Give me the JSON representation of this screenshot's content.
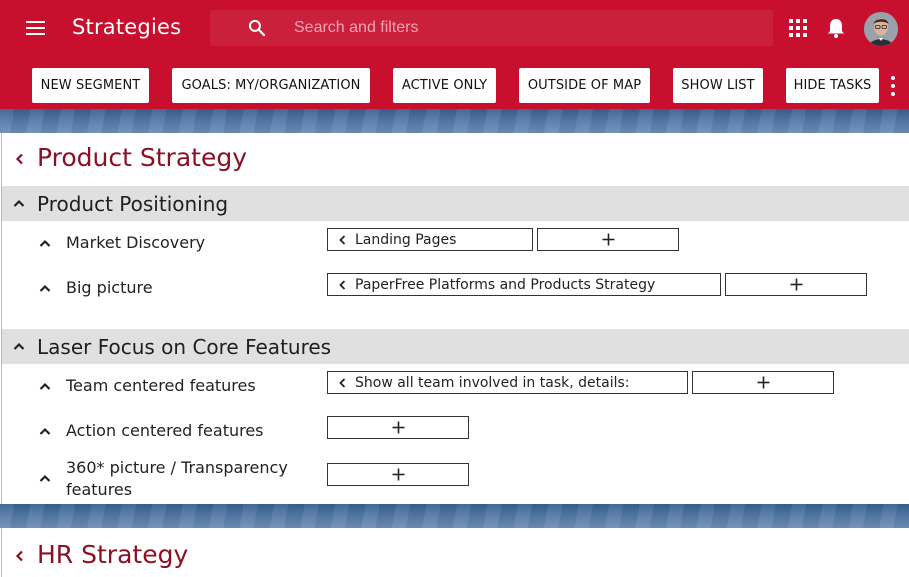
{
  "app": {
    "title": "Strategies"
  },
  "search": {
    "placeholder": "Search and filters"
  },
  "toolbar": {
    "chips": [
      "NEW SEGMENT",
      "GOALS: MY/ORGANIZATION",
      "ACTIVE ONLY",
      "OUTSIDE OF MAP",
      "SHOW LIST",
      "HIDE TASKS"
    ]
  },
  "icons": {
    "menu": "menu-icon",
    "search": "search-icon",
    "apps": "apps-grid-icon",
    "notifications": "bell-icon",
    "more": "more-vert-icon"
  },
  "colors": {
    "brand": "#c8102e",
    "title_accent": "#8b1024",
    "section_bg": "#e0e0e0"
  },
  "strategies": [
    {
      "title": "Product Strategy",
      "sections": [
        {
          "title": "Product Positioning",
          "rows": [
            {
              "label": "Market Discovery",
              "tasks": [
                "Landing Pages"
              ]
            },
            {
              "label": "Big picture",
              "tasks": [
                "PaperFree Platforms and Products Strategy"
              ]
            }
          ]
        },
        {
          "title": "Laser Focus on Core Features",
          "rows": [
            {
              "label": "Team centered features",
              "tasks": [
                "Show all team involved in task, details:"
              ]
            },
            {
              "label": "Action centered features",
              "tasks": []
            },
            {
              "label": "360* picture / Transparency features",
              "tasks": []
            }
          ]
        }
      ]
    },
    {
      "title": "HR Strategy"
    }
  ]
}
